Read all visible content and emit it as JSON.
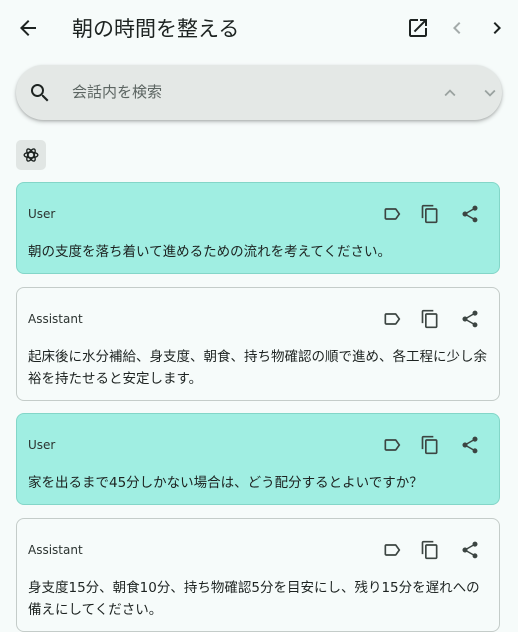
{
  "header": {
    "title": "朝の時間を整える",
    "icons": {
      "back": "arrow-left-icon",
      "open": "open-in-new-icon",
      "prev": "chevron-left-icon",
      "next": "chevron-right-icon"
    }
  },
  "search": {
    "placeholder": "会話内を検索",
    "value": "",
    "icons": {
      "search": "search-icon",
      "up": "chevron-up-icon",
      "down": "chevron-down-icon"
    }
  },
  "model": {
    "icon": "openai-logo-icon"
  },
  "messages": [
    {
      "role": "User",
      "text": "朝の支度を落ち着いて進めるための流れを考えてください。"
    },
    {
      "role": "Assistant",
      "text": "起床後に水分補給、身支度、朝食、持ち物確認の順で進め、各工程に少し余裕を持たせると安定します。"
    },
    {
      "role": "User",
      "text": "家を出るまで45分しかない場合は、どう配分するとよいですか？"
    },
    {
      "role": "Assistant",
      "text": "身支度15分、朝食10分、持ち物確認5分を目安にし、残り15分を遅れへの備えにしてください。"
    }
  ],
  "message_actions": {
    "label": "label-icon",
    "copy": "copy-icon",
    "share": "share-icon"
  },
  "colors": {
    "background": "#f6fbfa",
    "user_bubble": "#a0eee2",
    "search_bar": "#e4e8e6",
    "icon": "#3c4542"
  }
}
